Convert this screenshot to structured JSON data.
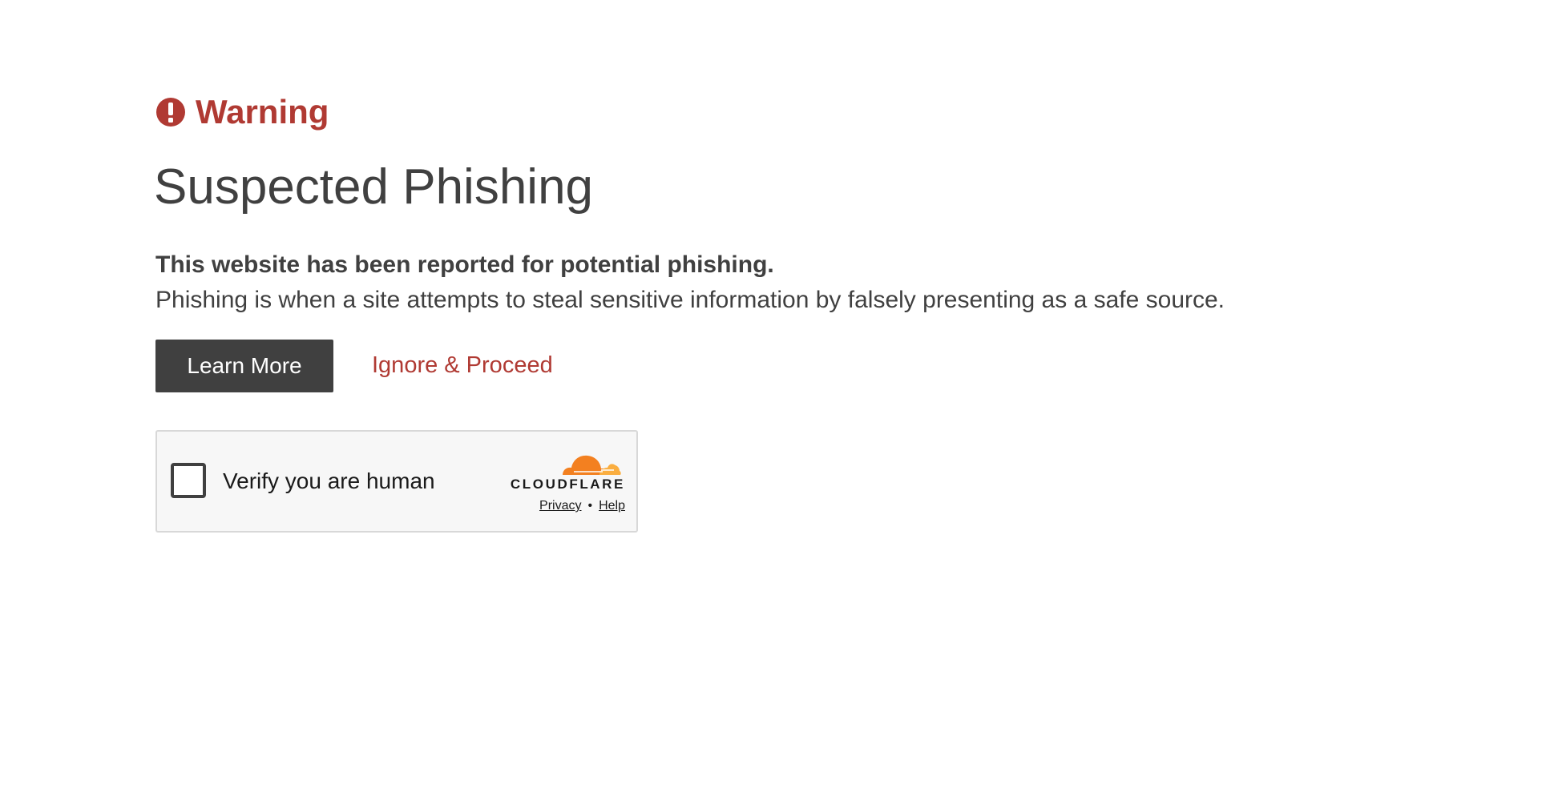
{
  "warning": {
    "icon": "exclamation-circle-icon",
    "label": "Warning",
    "color": "#b03a33"
  },
  "title": "Suspected Phishing",
  "headline": "This website has been reported for potential phishing.",
  "description": "Phishing is when a site attempts to steal sensitive information by falsely presenting as a safe source.",
  "actions": {
    "learn_more_label": "Learn More",
    "proceed_label": "Ignore & Proceed"
  },
  "captcha": {
    "checkbox_checked": false,
    "label": "Verify you are human",
    "brand": "CLOUDFLARE",
    "brand_icon": "cloudflare-cloud-icon",
    "privacy_label": "Privacy",
    "separator": "•",
    "help_label": "Help",
    "brand_colors": [
      "#f38020",
      "#faae40"
    ]
  },
  "colors": {
    "accent": "#b03a33",
    "text": "#404040",
    "button_bg": "#404040"
  }
}
